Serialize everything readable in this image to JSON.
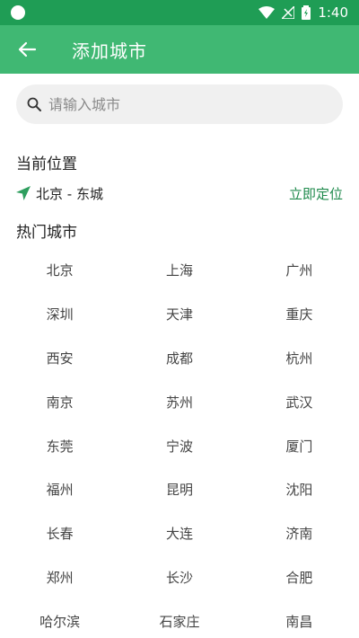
{
  "status_bar": {
    "time": "1:40"
  },
  "header": {
    "title": "添加城市"
  },
  "search": {
    "placeholder": "请输入城市"
  },
  "current_location": {
    "section_title": "当前位置",
    "location": "北京 - 东城",
    "locate_label": "立即定位"
  },
  "hot_cities": {
    "section_title": "热门城市",
    "items": [
      "北京",
      "上海",
      "广州",
      "深圳",
      "天津",
      "重庆",
      "西安",
      "成都",
      "杭州",
      "南京",
      "苏州",
      "武汉",
      "东莞",
      "宁波",
      "厦门",
      "福州",
      "昆明",
      "沈阳",
      "长春",
      "大连",
      "济南",
      "郑州",
      "长沙",
      "合肥",
      "哈尔滨",
      "石家庄",
      "南昌"
    ]
  },
  "colors": {
    "status_bar": "#1f9d55",
    "app_bar": "#40b873",
    "accent": "#1f8a4c"
  }
}
